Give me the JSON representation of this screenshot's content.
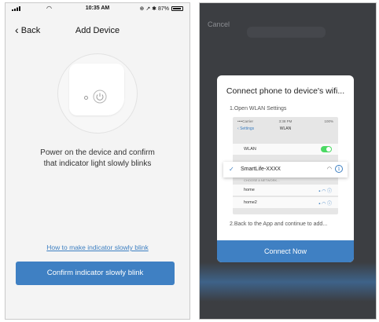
{
  "left": {
    "status": {
      "time": "10:35 AM",
      "right_text": "⊕ ↗ ✱ 87%"
    },
    "nav": {
      "back_label": "Back",
      "title": "Add Device"
    },
    "instruction_line1": "Power on the device and confirm",
    "instruction_line2": "that indicator light slowly blinks",
    "hint_link": "How to make indicator slowly blink",
    "confirm_button": "Confirm indicator slowly blink"
  },
  "right": {
    "cancel_label": "Cancel",
    "dialog": {
      "title": "Connect phone to device's wifi...",
      "step1": "1.Open WLAN Settings",
      "step2": "2.Back to the App and continue to add...",
      "connect_button": "Connect Now",
      "mock": {
        "carrier": "••••Carrier",
        "time": "3:38 PM",
        "battery": "100%",
        "back_label": "Settings",
        "title": "WLAN",
        "wlan_label": "WLAN",
        "selected_network": "SmartLife-XXXX",
        "section_header": "CHOOSE A NETWORK...",
        "networks": [
          "home",
          "home2"
        ]
      }
    }
  },
  "colors": {
    "accent": "#3f80c3",
    "link": "#3d7fc1",
    "toggle_on": "#4cd964"
  },
  "icons": [
    "signal-icon",
    "wifi-icon",
    "battery-icon",
    "chevron-left-icon",
    "power-icon",
    "check-icon",
    "info-icon",
    "lock-icon"
  ]
}
